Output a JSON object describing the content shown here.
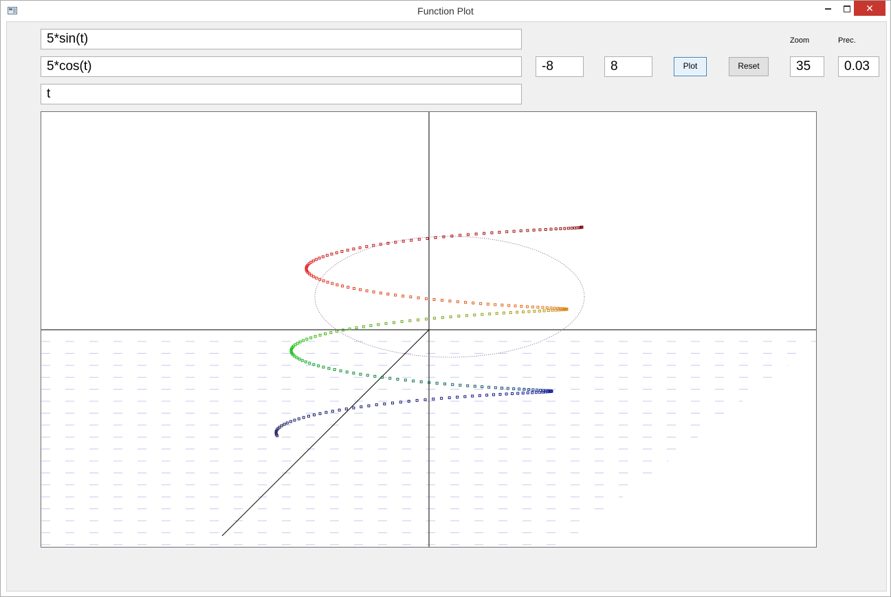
{
  "window": {
    "title": "Function Plot",
    "controls": {
      "minimize_icon": "minimize-icon",
      "maximize_icon": "maximize-icon",
      "close_icon": "close-icon",
      "close_glyph": "✕"
    }
  },
  "inputs": {
    "x_expr": "5*sin(t)",
    "y_expr": "5*cos(t)",
    "z_expr": "t",
    "t_min": "-8",
    "t_max": "8",
    "zoom": "35",
    "precision": "0.03"
  },
  "labels": {
    "zoom": "Zoom",
    "precision": "Prec."
  },
  "buttons": {
    "plot": "Plot",
    "reset": "Reset"
  },
  "plot_colors": {
    "axis": "#000000",
    "grid_dash": "#c8c8f0",
    "curve_start": "#1e1e5a",
    "curve_blue": "#1a1aa0",
    "curve_green": "#10c010",
    "curve_orange": "#e08c1e",
    "curve_red": "#e01a1a",
    "curve_end": "#7a1010"
  }
}
